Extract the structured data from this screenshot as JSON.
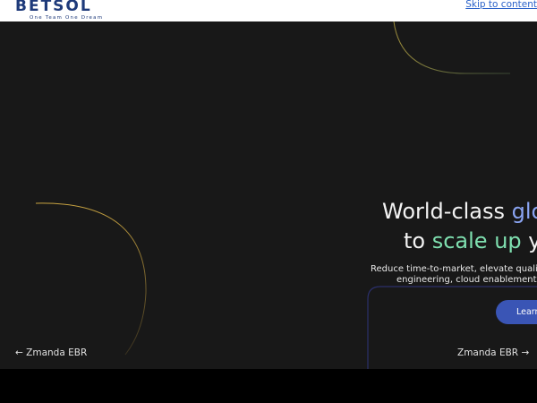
{
  "header": {
    "logo_text": "BETSOL",
    "logo_tagline": "One Team One Dream",
    "skip_link": "Skip to content"
  },
  "hero": {
    "headline_line1_prefix": "World-class ",
    "headline_line1_highlight": "glo",
    "headline_line2_prefix": "to ",
    "headline_line2_highlight": "scale up",
    "headline_line2_suffix": " y",
    "description_line1": "Reduce time-to-market, elevate quality,",
    "description_line2": "engineering, cloud enablement, i",
    "cta_label": "Learn"
  },
  "slider": {
    "prev_label": "Zmanda EBR",
    "next_label": "Zmanda EBR",
    "prev_arrow": "←",
    "next_arrow": "→"
  },
  "colors": {
    "hero_background": "#181818",
    "highlight_blue": "#8aa4f2",
    "highlight_green": "#7fe0b0",
    "cta_background": "#3a55b5",
    "logo_blue": "#1e3a7a",
    "link_blue": "#2a62c9"
  }
}
